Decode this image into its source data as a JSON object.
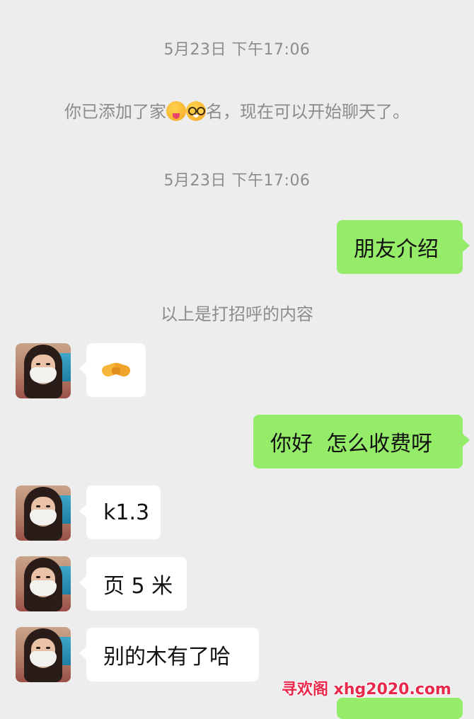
{
  "conversation": {
    "timestamp_1": "5月23日 下午17:06",
    "added_prefix": "你已添加了家",
    "added_suffix": "名，现在可以开始聊天了。",
    "emoji_1": "zany-face-emoji",
    "emoji_2": "nerd-face-emoji",
    "timestamp_2": "5月23日 下午17:06",
    "greeting_note": "以上是打招呼的内容"
  },
  "messages": [
    {
      "sender": "me",
      "text": "朋友介绍"
    },
    {
      "sender": "contact",
      "icon": "handshake-emoji"
    },
    {
      "sender": "me",
      "text": "你好  怎么收费呀"
    },
    {
      "sender": "contact",
      "text": "k1.3"
    },
    {
      "sender": "contact",
      "text": "页 5 米"
    },
    {
      "sender": "contact",
      "text": "别的木有了哈"
    }
  ],
  "watermark": {
    "text": "寻欢阁 xhg2020.com"
  },
  "colors": {
    "background": "#ededed",
    "sent_bubble": "#95ec69",
    "received_bubble": "#ffffff",
    "system_text": "#8c8c8c",
    "watermark": "#e8294b"
  }
}
